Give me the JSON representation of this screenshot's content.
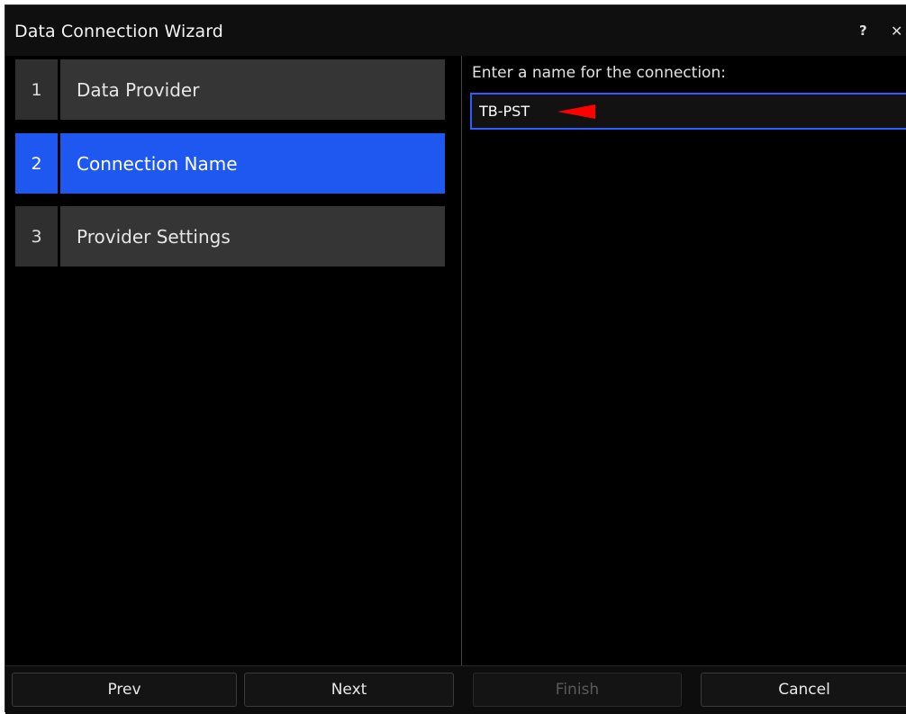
{
  "window": {
    "title": "Data Connection Wizard",
    "help_label": "?",
    "close_label": "✕"
  },
  "steps": [
    {
      "number": "1",
      "label": "Data Provider",
      "state": "inactive"
    },
    {
      "number": "2",
      "label": "Connection Name",
      "state": "active"
    },
    {
      "number": "3",
      "label": "Provider Settings",
      "state": "inactive"
    }
  ],
  "main": {
    "prompt": "Enter a name for the connection:",
    "name_value": "TB-PST",
    "annotation_icon": "red-left-arrow-icon"
  },
  "buttons": {
    "prev": "Prev",
    "next": "Next",
    "finish": "Finish",
    "cancel": "Cancel"
  },
  "colors": {
    "accent": "#1f58f0",
    "input_border": "#2d5cff",
    "annotation": "#ff0000",
    "background": "#000000"
  }
}
